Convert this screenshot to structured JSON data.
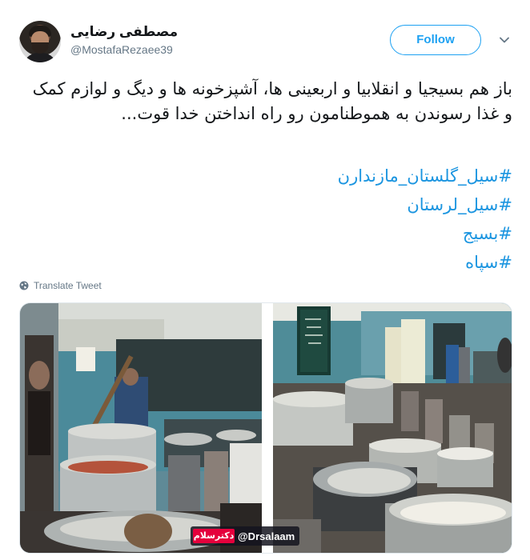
{
  "user": {
    "display_name": "مصطفی رضایی",
    "handle": "@MostafaRezaee39"
  },
  "actions": {
    "follow_label": "Follow"
  },
  "tweet": {
    "text": "باز هم بسیجیا و انقلابیا و اربعینی ها، آشپزخونه ها و دیگ و لوازم کمک و غذا رسوندن به هموطنامون رو راه انداختن خدا قوت...",
    "hashtags": [
      "#سیل_گلستان_مازندارن",
      "#سیل_لرستان",
      "#بسیج",
      "#سپاه"
    ],
    "translate_label": "Translate Tweet"
  },
  "media": {
    "watermark_logo": "دکترسلام",
    "watermark_handle": "@Drsalaam"
  },
  "colors": {
    "accent": "#1da1f2",
    "hashtag": "#1b95e0",
    "muted": "#657786"
  }
}
